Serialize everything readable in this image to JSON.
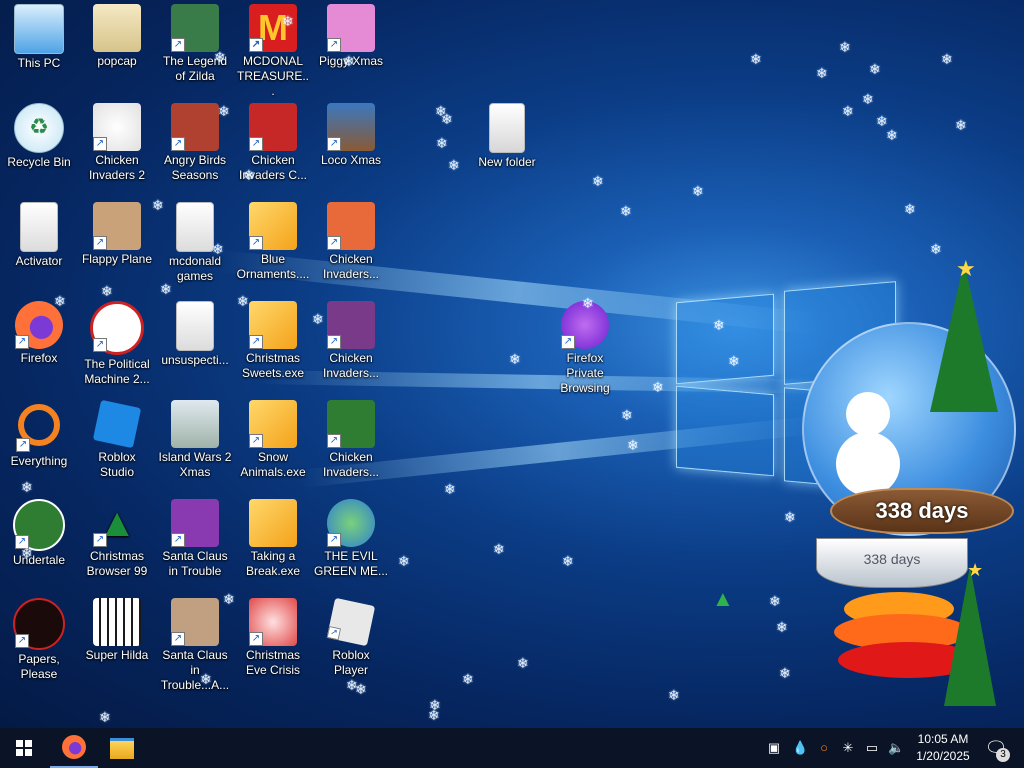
{
  "desktop": {
    "icons": [
      {
        "label": "This PC",
        "icon": "this-pc-icon",
        "shortcut": false,
        "color": "#4fa3e6"
      },
      {
        "label": "popcap",
        "icon": "folder-icon",
        "shortcut": false,
        "color": "#e8d8a8"
      },
      {
        "label": "The Legend of Zilda",
        "icon": "game-icon",
        "shortcut": true,
        "color": "#3a7b4a"
      },
      {
        "label": "MCDONAL TREASURE...",
        "icon": "mcdonalds-icon",
        "shortcut": true,
        "color": "#d81e1e"
      },
      {
        "label": "Piggy Xmas",
        "icon": "pig-icon",
        "shortcut": true,
        "color": "#e58bd6"
      },
      {
        "label": "Recycle Bin",
        "icon": "recycle-bin-icon",
        "shortcut": false,
        "color": "#bfe3f5"
      },
      {
        "label": "Chicken Invaders 2",
        "icon": "chicken-icon",
        "shortcut": true,
        "color": "#f0f0f0"
      },
      {
        "label": "Angry Birds Seasons",
        "icon": "angry-birds-icon",
        "shortcut": true,
        "color": "#b04030"
      },
      {
        "label": "Chicken Invaders C...",
        "icon": "chicken-icon",
        "shortcut": true,
        "color": "#c62828"
      },
      {
        "label": "Loco Xmas",
        "icon": "bear-icon",
        "shortcut": true,
        "color": "#3a78c0"
      },
      {
        "label": "Activator",
        "icon": "file-icon",
        "shortcut": false,
        "color": "#f2f2f2"
      },
      {
        "label": "Flappy Plane",
        "icon": "plane-icon",
        "shortcut": true,
        "color": "#c9a27a"
      },
      {
        "label": "mcdonald games",
        "icon": "file-icon",
        "shortcut": false,
        "color": "#f2f2f2"
      },
      {
        "label": "Blue Ornaments....",
        "icon": "exe-icon",
        "shortcut": true,
        "color": "#f4b43a"
      },
      {
        "label": "Chicken Invaders...",
        "icon": "chicken-icon",
        "shortcut": true,
        "color": "#e86a3a"
      },
      {
        "label": "Firefox",
        "icon": "firefox-icon",
        "shortcut": true,
        "color": "#ff7139"
      },
      {
        "label": "The Political Machine 2...",
        "icon": "political-icon",
        "shortcut": true,
        "color": "#ffffff"
      },
      {
        "label": "unsuspecti...",
        "icon": "file-icon",
        "shortcut": false,
        "color": "#f2f2f2"
      },
      {
        "label": "Christmas Sweets.exe",
        "icon": "exe-icon",
        "shortcut": true,
        "color": "#f4b43a"
      },
      {
        "label": "Chicken Invaders...",
        "icon": "chicken-icon",
        "shortcut": true,
        "color": "#7a3a8a"
      },
      {
        "label": "Everything",
        "icon": "search-icon",
        "shortcut": true,
        "color": "#f58220"
      },
      {
        "label": "Roblox Studio",
        "icon": "roblox-studio-icon",
        "shortcut": false,
        "color": "#1e88e5"
      },
      {
        "label": "Island Wars 2 Xmas",
        "icon": "island-icon",
        "shortcut": false,
        "color": "#c8d8d0"
      },
      {
        "label": "Snow Animals.exe",
        "icon": "exe-icon",
        "shortcut": true,
        "color": "#f4b43a"
      },
      {
        "label": "Chicken Invaders...",
        "icon": "chicken-icon",
        "shortcut": true,
        "color": "#2e7d32"
      },
      {
        "label": "Undertale",
        "icon": "undertale-icon",
        "shortcut": true,
        "color": "#2e7d32"
      },
      {
        "label": "Christmas Browser 99",
        "icon": "xmas-tree-icon",
        "shortcut": true,
        "color": "#1b5e20"
      },
      {
        "label": "Santa Claus in Trouble",
        "icon": "santa-icon",
        "shortcut": true,
        "color": "#8a3ab0"
      },
      {
        "label": "Taking a Break.exe",
        "icon": "exe-icon",
        "shortcut": false,
        "color": "#f4b43a"
      },
      {
        "label": "THE EVIL GREEN ME...",
        "icon": "messenger-icon",
        "shortcut": true,
        "color": "#3c9a3c"
      },
      {
        "label": "Papers, Please",
        "icon": "papers-please-icon",
        "shortcut": true,
        "color": "#1a0a0a"
      },
      {
        "label": "Super Hilda",
        "icon": "pixel-icon",
        "shortcut": false,
        "color": "#f5f0d0"
      },
      {
        "label": "Santa Claus in Trouble...A...",
        "icon": "santa-icon",
        "shortcut": true,
        "color": "#c0a080"
      },
      {
        "label": "Christmas Eve Crisis",
        "icon": "santa-icon",
        "shortcut": true,
        "color": "#e04848"
      },
      {
        "label": "Roblox Player",
        "icon": "roblox-icon",
        "shortcut": true,
        "color": "#e8e8e8"
      },
      {
        "label": "New folder",
        "icon": "folder-icon",
        "shortcut": false,
        "color": "#f2f2f2"
      },
      {
        "label": "Firefox Private Browsing",
        "icon": "firefox-private-icon",
        "shortcut": true,
        "color": "#8a3ae0"
      }
    ],
    "widget": {
      "days_label": "338 days",
      "days_label_small": "338 days"
    }
  },
  "taskbar": {
    "time": "10:05 AM",
    "date": "1/20/2025",
    "notification_count": "3",
    "pinned": [
      "start-button",
      "firefox",
      "file-explorer"
    ]
  }
}
